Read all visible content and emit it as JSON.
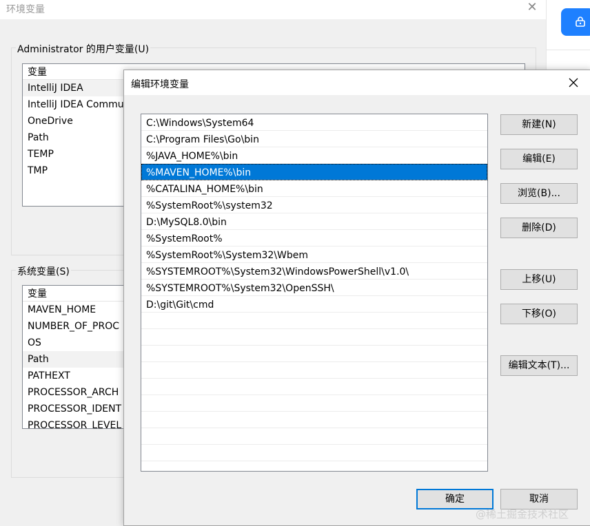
{
  "bg_window": {
    "title": "环境变量",
    "user_group_label": "Administrator 的用户变量(U)",
    "user_list_header": "变量",
    "user_vars": [
      "IntelliJ IDEA",
      "IntelliJ IDEA Commu",
      "OneDrive",
      "Path",
      "TEMP",
      "TMP"
    ],
    "system_group_label": "系统变量(S)",
    "system_list_header": "变量",
    "system_vars": [
      "MAVEN_HOME",
      "NUMBER_OF_PROC",
      "OS",
      "Path",
      "PATHEXT",
      "PROCESSOR_ARCH",
      "PROCESSOR_IDENT",
      "PROCESSOR_LEVEL"
    ]
  },
  "dialog": {
    "title": "编辑环境变量",
    "paths": [
      "C:\\Windows\\System64",
      "C:\\Program Files\\Go\\bin",
      "%JAVA_HOME%\\bin",
      "%MAVEN_HOME%\\bin",
      "%CATALINA_HOME%\\bin",
      "%SystemRoot%\\system32",
      "D:\\MySQL8.0\\bin",
      "%SystemRoot%",
      "%SystemRoot%\\System32\\Wbem",
      "%SYSTEMROOT%\\System32\\WindowsPowerShell\\v1.0\\",
      "%SYSTEMROOT%\\System32\\OpenSSH\\",
      "D:\\git\\Git\\cmd"
    ],
    "selected_path": "%MAVEN_HOME%\\bin",
    "buttons": {
      "new": "新建(N)",
      "edit": "编辑(E)",
      "browse": "浏览(B)...",
      "delete": "删除(D)",
      "move_up": "上移(U)",
      "move_down": "下移(O)",
      "edit_text": "编辑文本(T)...",
      "ok": "确定",
      "cancel": "取消"
    }
  },
  "watermark": "@稀土掘金技术社区",
  "colors": {
    "selection": "#0078d7",
    "accent_button": "#1e80ff"
  }
}
